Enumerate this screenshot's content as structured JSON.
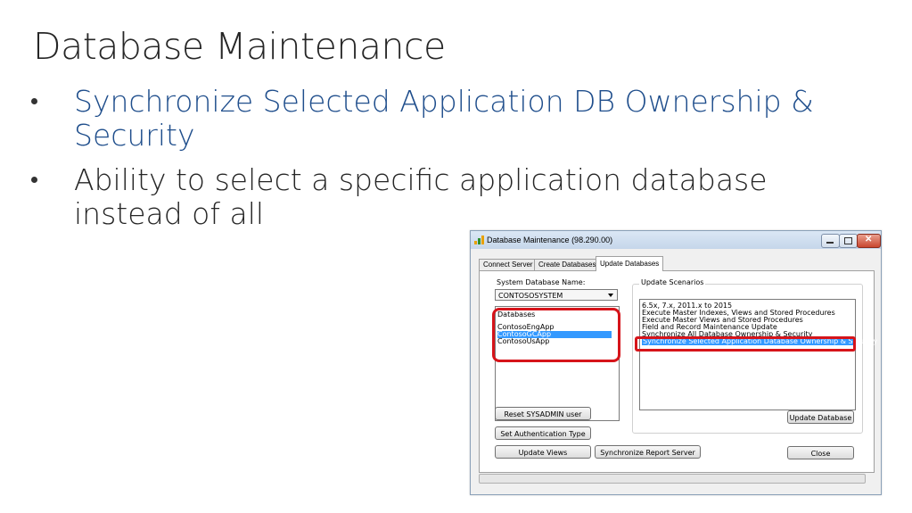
{
  "slide": {
    "title": "Database Maintenance",
    "bullets": [
      "Synchronize Selected Application DB Ownership & Security",
      "Ability to select a specific application database instead of all"
    ]
  },
  "window": {
    "title": "Database Maintenance (98.290.00)",
    "tabs": [
      "Connect Server",
      "Create Databases",
      "Update Databases"
    ],
    "active_tab": "Update Databases"
  },
  "form": {
    "system_db_label": "System Database Name:",
    "system_db_value": "CONTOSOSYSTEM",
    "databases_label": "Databases",
    "databases": [
      "ContosoEngApp",
      "ContosoGCApp",
      "ContosoUsApp"
    ],
    "selected_database": "ContosoGCApp",
    "scenarios_label": "Update Scenarios",
    "scenarios": [
      "6.5x, 7.x, 2011.x to 2015",
      "Execute Master Indexes, Views and Stored Procedures",
      "Execute Master Views and Stored Procedures",
      "Field and Record Maintenance Update",
      "Synchronize All Database Ownership & Security",
      "Synchronize Selected Application Database Ownership & Security"
    ],
    "selected_scenario": "Synchronize Selected Application Database Ownership & Security"
  },
  "buttons": {
    "reset_sysadmin": "Reset SYSADMIN user",
    "set_auth": "Set Authentication Type",
    "update_views": "Update Views",
    "sync_report": "Synchronize Report Server",
    "update_database": "Update Database",
    "close": "Close"
  },
  "colors": {
    "highlight": "#d6141a",
    "selection": "#3399ff",
    "bullet_accent": "#1f4e8c"
  }
}
